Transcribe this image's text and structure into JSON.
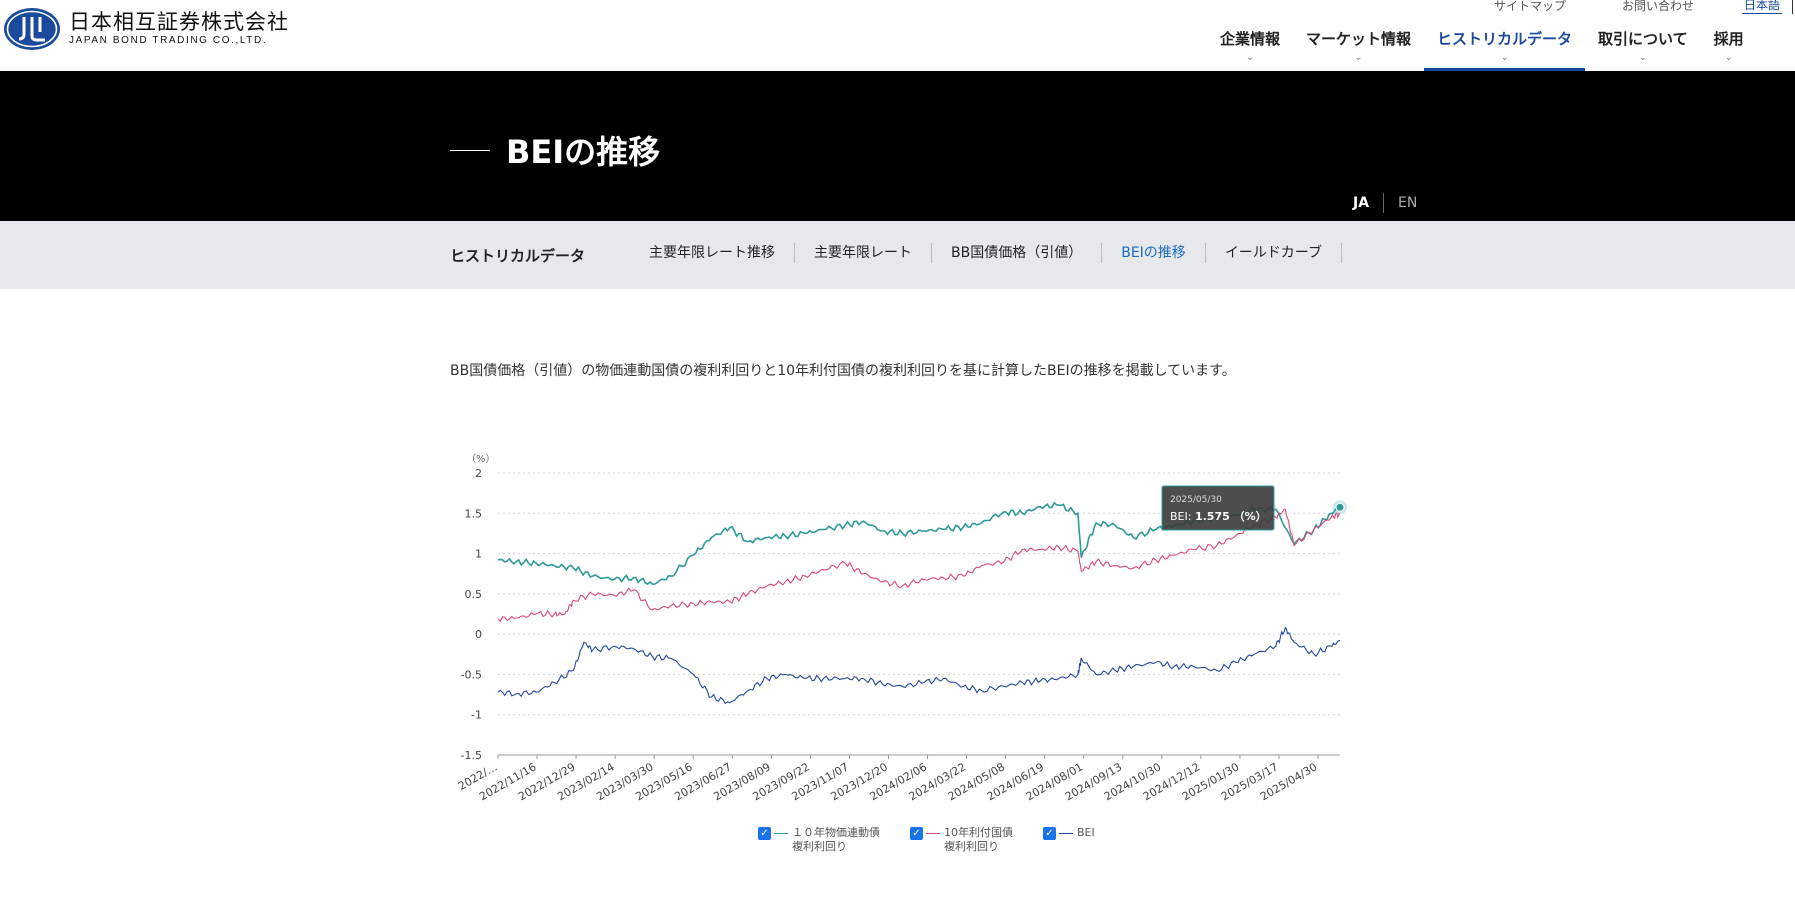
{
  "logo": {
    "jp": "日本相互証券株式会社",
    "en": "JAPAN BOND TRADING CO.,LTD."
  },
  "utility_nav": {
    "sitemap": "サイトマップ",
    "contact": "お問い合わせ",
    "language": "日本語"
  },
  "main_nav": [
    {
      "label": "企業情報",
      "active": false
    },
    {
      "label": "マーケット情報",
      "active": false
    },
    {
      "label": "ヒストリカルデータ",
      "active": true
    },
    {
      "label": "取引について",
      "active": false
    },
    {
      "label": "採用",
      "active": false
    }
  ],
  "hero": {
    "title": "BEIの推移",
    "lang_ja": "JA",
    "lang_en": "EN"
  },
  "subnav": {
    "title": "ヒストリカルデータ",
    "links": [
      {
        "label": "主要年限レート推移",
        "active": false
      },
      {
        "label": "主要年限レート",
        "active": false
      },
      {
        "label": "BB国債価格（引値）",
        "active": false
      },
      {
        "label": "BEIの推移",
        "active": true
      },
      {
        "label": "イールドカーブ",
        "active": false
      }
    ]
  },
  "intro_text": "BB国債価格（引値）の物価連動国債の複利利回りと10年利付国債の複利利回りを基に計算したBEIの推移を掲載しています。",
  "tooltip": {
    "date": "2025/05/30",
    "label": "BEI:",
    "value": "1.575",
    "unit": "（%）"
  },
  "colors": {
    "series_teal": "#2e9a98",
    "series_pink": "#d9487a",
    "series_blue": "#23499a",
    "accent": "#1a4a9c"
  },
  "chart_data": {
    "type": "line",
    "y_unit_label": "（%）",
    "ylim": [
      -1.5,
      2
    ],
    "y_ticks": [
      "2",
      "1.5",
      "1",
      "0.5",
      "0",
      "-0.5",
      "-1",
      "-1.5"
    ],
    "x_ticks": [
      "2022/…",
      "2022/11/16",
      "2022/12/29",
      "2023/02/14",
      "2023/03/30",
      "2023/05/16",
      "2023/06/27",
      "2023/08/09",
      "2023/09/22",
      "2023/11/07",
      "2023/12/20",
      "2024/02/06",
      "2024/03/22",
      "2024/05/08",
      "2024/06/19",
      "2024/08/01",
      "2024/09/13",
      "2024/10/30",
      "2024/12/12",
      "2025/01/30",
      "2025/03/17",
      "2025/04/30"
    ],
    "grid": true,
    "legend_position": "bottom",
    "series": [
      {
        "name": "１０年物価連動債\n複利利回り",
        "color": "#2e9a98",
        "x": [
          "2022/10/03",
          "2022/10/24",
          "2022/11/16",
          "2022/12/07",
          "2022/12/29",
          "2023/01/20",
          "2023/02/14",
          "2023/03/08",
          "2023/03/30",
          "2023/04/20",
          "2023/05/16",
          "2023/06/06",
          "2023/06/27",
          "2023/07/18",
          "2023/08/09",
          "2023/08/30",
          "2023/09/22",
          "2023/10/13",
          "2023/11/07",
          "2023/11/28",
          "2023/12/20",
          "2024/01/12",
          "2024/02/06",
          "2024/02/28",
          "2024/03/22",
          "2024/04/12",
          "2024/05/08",
          "2024/05/29",
          "2024/06/19",
          "2024/07/10",
          "2024/08/01",
          "2024/08/05",
          "2024/08/22",
          "2024/09/13",
          "2024/10/04",
          "2024/10/30",
          "2024/11/20",
          "2024/12/12",
          "2025/01/08",
          "2025/01/30",
          "2025/02/20",
          "2025/03/17",
          "2025/04/07",
          "2025/04/30",
          "2025/05/20",
          "2025/05/30"
        ],
        "y": [
          0.92,
          0.9,
          0.88,
          0.85,
          0.82,
          0.72,
          0.68,
          0.7,
          0.62,
          0.72,
          0.98,
          1.2,
          1.32,
          1.15,
          1.2,
          1.22,
          1.25,
          1.3,
          1.35,
          1.4,
          1.28,
          1.25,
          1.28,
          1.3,
          1.33,
          1.38,
          1.52,
          1.5,
          1.58,
          1.6,
          1.5,
          0.95,
          1.38,
          1.35,
          1.2,
          1.3,
          1.35,
          1.4,
          1.45,
          1.48,
          1.55,
          1.55,
          1.12,
          1.3,
          1.5,
          1.575
        ]
      },
      {
        "name": "10年利付国債\n複利利回り",
        "color": "#d9487a",
        "x": [
          "2022/10/03",
          "2022/10/24",
          "2022/11/16",
          "2022/12/07",
          "2022/12/19",
          "2022/12/29",
          "2023/01/20",
          "2023/02/14",
          "2023/03/08",
          "2023/03/30",
          "2023/04/20",
          "2023/05/16",
          "2023/06/06",
          "2023/06/27",
          "2023/07/18",
          "2023/08/09",
          "2023/08/30",
          "2023/09/22",
          "2023/10/13",
          "2023/11/07",
          "2023/11/28",
          "2023/12/20",
          "2024/01/12",
          "2024/02/06",
          "2024/02/28",
          "2024/03/22",
          "2024/04/12",
          "2024/05/08",
          "2024/05/29",
          "2024/06/19",
          "2024/07/10",
          "2024/08/01",
          "2024/08/05",
          "2024/08/22",
          "2024/09/13",
          "2024/10/04",
          "2024/10/30",
          "2024/11/20",
          "2024/12/12",
          "2025/01/08",
          "2025/01/30",
          "2025/02/20",
          "2025/03/17",
          "2025/03/28",
          "2025/04/07",
          "2025/04/30",
          "2025/05/20",
          "2025/05/30"
        ],
        "y": [
          0.19,
          0.2,
          0.25,
          0.25,
          0.25,
          0.42,
          0.5,
          0.48,
          0.55,
          0.3,
          0.35,
          0.38,
          0.4,
          0.4,
          0.5,
          0.6,
          0.65,
          0.72,
          0.8,
          0.88,
          0.75,
          0.65,
          0.6,
          0.68,
          0.7,
          0.72,
          0.85,
          0.9,
          1.05,
          1.05,
          1.08,
          1.03,
          0.78,
          0.9,
          0.85,
          0.82,
          0.92,
          0.98,
          1.05,
          1.1,
          1.22,
          1.35,
          1.45,
          1.55,
          1.1,
          1.3,
          1.45,
          1.5
        ]
      },
      {
        "name": "BEI",
        "color": "#23499a",
        "x": [
          "2022/10/03",
          "2022/10/24",
          "2022/11/16",
          "2022/12/07",
          "2022/12/29",
          "2023/01/10",
          "2023/01/20",
          "2023/02/14",
          "2023/03/08",
          "2023/03/30",
          "2023/04/20",
          "2023/05/16",
          "2023/06/06",
          "2023/06/27",
          "2023/07/18",
          "2023/08/09",
          "2023/08/30",
          "2023/09/22",
          "2023/10/13",
          "2023/11/07",
          "2023/11/28",
          "2023/12/20",
          "2024/01/12",
          "2024/02/06",
          "2024/02/28",
          "2024/03/22",
          "2024/04/12",
          "2024/05/08",
          "2024/05/29",
          "2024/06/19",
          "2024/07/10",
          "2024/08/01",
          "2024/08/05",
          "2024/08/22",
          "2024/09/13",
          "2024/10/04",
          "2024/10/30",
          "2024/11/20",
          "2024/12/12",
          "2025/01/08",
          "2025/01/30",
          "2025/02/20",
          "2025/03/17",
          "2025/03/28",
          "2025/04/07",
          "2025/04/30",
          "2025/05/20",
          "2025/05/30"
        ],
        "y": [
          -0.72,
          -0.74,
          -0.72,
          -0.6,
          -0.45,
          -0.1,
          -0.2,
          -0.15,
          -0.18,
          -0.28,
          -0.3,
          -0.5,
          -0.78,
          -0.85,
          -0.7,
          -0.55,
          -0.5,
          -0.55,
          -0.55,
          -0.55,
          -0.55,
          -0.62,
          -0.65,
          -0.6,
          -0.55,
          -0.65,
          -0.7,
          -0.65,
          -0.6,
          -0.58,
          -0.55,
          -0.5,
          -0.3,
          -0.5,
          -0.45,
          -0.4,
          -0.35,
          -0.4,
          -0.4,
          -0.45,
          -0.35,
          -0.25,
          -0.15,
          0.08,
          -0.1,
          -0.25,
          -0.15,
          -0.08
        ]
      }
    ]
  }
}
